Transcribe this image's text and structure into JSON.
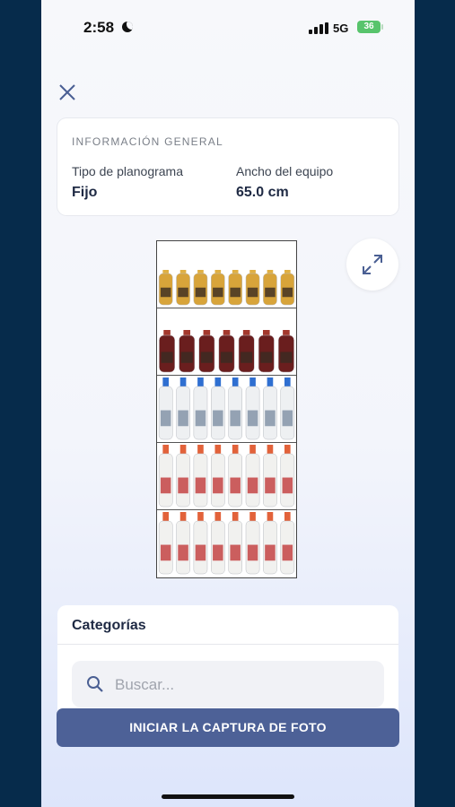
{
  "status_bar": {
    "time": "2:58",
    "network": "5G",
    "battery": "36"
  },
  "info": {
    "title": "INFORMACIÓN GENERAL",
    "fields": [
      {
        "label": "Tipo de planograma",
        "value": "Fijo"
      },
      {
        "label": "Ancho del equipo",
        "value": "65.0 cm"
      }
    ]
  },
  "planogram": {
    "shelves": [
      {
        "product": "mustard-sauce-bottle",
        "count": 8,
        "colors": [
          "#d8a43a",
          "#e0b042"
        ]
      },
      {
        "product": "chili-sauce-bottle",
        "count": 7,
        "colors": [
          "#6a1e1e",
          "#a3382d"
        ]
      },
      {
        "product": "milk-bottle-blue-cap",
        "count": 8,
        "colors": [
          "#eef0f2",
          "#2f6fd1"
        ]
      },
      {
        "product": "milk-bottle-orange-cap",
        "count": 8,
        "colors": [
          "#f1f1ef",
          "#e2623a"
        ]
      },
      {
        "product": "milk-bottle-orange-cap",
        "count": 8,
        "colors": [
          "#f1f1ef",
          "#e2623a"
        ]
      }
    ]
  },
  "categories": {
    "title": "Categorías",
    "search_placeholder": "Buscar..."
  },
  "actions": {
    "capture_label": "INICIAR LA CAPTURA DE FOTO"
  },
  "colors": {
    "accent": "#4d6197",
    "page_bg": "#062b4b"
  },
  "icons": [
    "close-icon",
    "expand-icon",
    "search-icon",
    "moon-icon",
    "signal-icon"
  ]
}
